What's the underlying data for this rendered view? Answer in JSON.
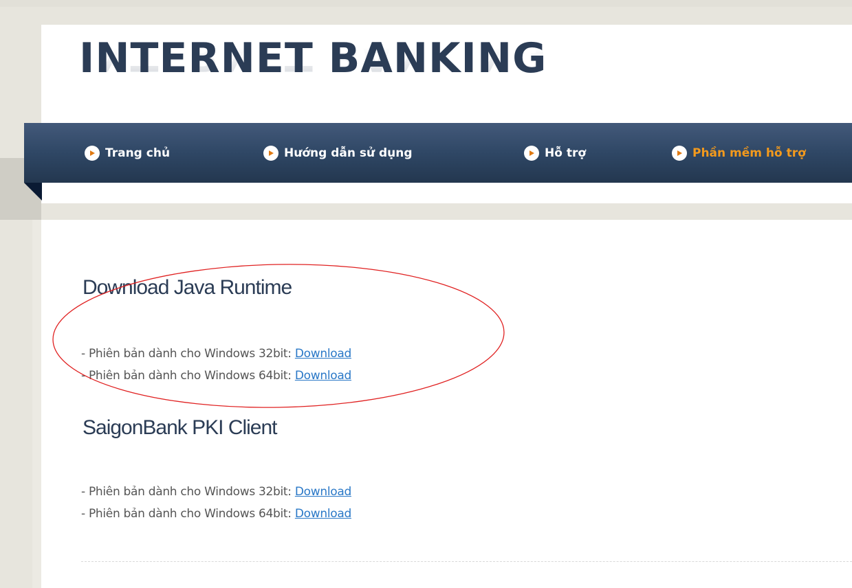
{
  "logo": {
    "text": "INTERNET BANKING"
  },
  "nav": {
    "items": [
      {
        "label": "Trang chủ",
        "active": false
      },
      {
        "label": "Hướng dẫn sử dụng",
        "active": false
      },
      {
        "label": "Hỗ trợ",
        "active": false
      },
      {
        "label": "Phần mềm hỗ trợ",
        "active": true
      }
    ]
  },
  "sections": [
    {
      "title": "Download Java Runtime",
      "rows": [
        {
          "prefix": "- Phiên bản dành cho Windows 32bit: ",
          "link": "Download"
        },
        {
          "prefix": "- Phiên bản dành cho Windows 64bit: ",
          "link": "Download"
        }
      ]
    },
    {
      "title": "SaigonBank PKI Client",
      "rows": [
        {
          "prefix": "- Phiên bản dành cho Windows 32bit: ",
          "link": "Download"
        },
        {
          "prefix": "- Phiên bản dành cho Windows 64bit: ",
          "link": "Download"
        }
      ]
    }
  ],
  "colors": {
    "nav_bg": "#2f4765",
    "nav_active": "#f39a1d",
    "title": "#2b3c55",
    "link": "#2a78c7",
    "annotation": "#e02020"
  }
}
